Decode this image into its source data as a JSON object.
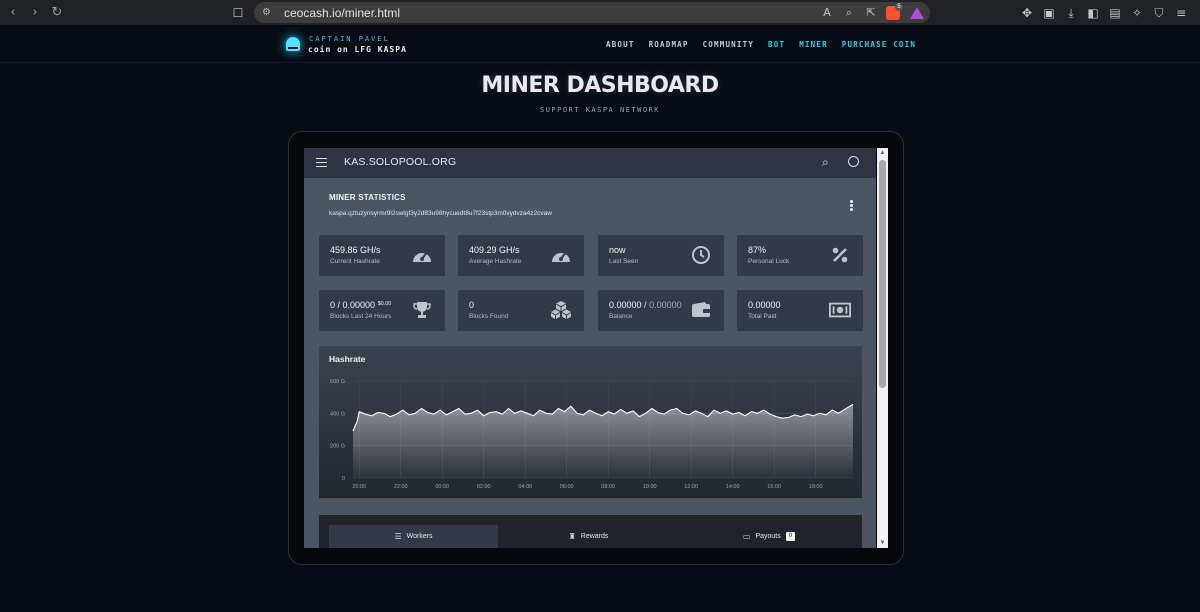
{
  "browser": {
    "url": "ceocash.io/miner.html",
    "extension_badge": "5"
  },
  "site": {
    "brand_top": "CAPTAIN PAVEL",
    "brand_bottom": "coin on LFG KASPA",
    "nav": [
      {
        "label": "ABOUT",
        "active": false
      },
      {
        "label": "ROADMAP",
        "active": false
      },
      {
        "label": "COMMUNITY",
        "active": false
      },
      {
        "label": "BOT",
        "active": true
      },
      {
        "label": "MINER",
        "active": true
      },
      {
        "label": "PURCHASE COIN",
        "active": true
      }
    ],
    "accent_color": "#22d3ee",
    "hero_title": "MINER DASHBOARD",
    "hero_subtitle": "SUPPORT KASPA NETWORK"
  },
  "app": {
    "title": "KAS.SOLOPOOL.ORG",
    "section_title": "MINER STATISTICS",
    "wallet_address": "kaspa:qztuzynsyrmr9l2swlgf3y2d83u98hycuedt8u7f23stp3m0vydvza4z2cvaw",
    "stats": [
      {
        "value": "459.86 GH/s",
        "label": "Current Hashrate",
        "icon": "gauge-icon"
      },
      {
        "value": "409.29 GH/s",
        "label": "Average Hashrate",
        "icon": "gauge-icon"
      },
      {
        "value": "now",
        "label": "Last Seen",
        "icon": "clock-icon"
      },
      {
        "value": "87%",
        "label": "Personal Luck",
        "icon": "percent-icon"
      },
      {
        "value": "0 / 0.00000",
        "value_sup": "$0.00",
        "label": "Blocks Last 24 Hours",
        "icon": "trophy-icon"
      },
      {
        "value": "0",
        "label": "Blocks Found",
        "icon": "cubes-icon"
      },
      {
        "value": "0.00000 /",
        "value_muted": "0.00000",
        "label": "Balance",
        "icon": "wallet-icon"
      },
      {
        "value": "0.00000",
        "label": "Total Paid",
        "icon": "money-bill-icon"
      }
    ],
    "tabs": [
      {
        "label": "Workers",
        "icon": "server-icon",
        "active": true
      },
      {
        "label": "Rewards",
        "icon": "trophy-icon",
        "active": false
      },
      {
        "label": "Payouts",
        "icon": "money-bill-icon",
        "active": false,
        "count": "0"
      }
    ]
  },
  "chart_data": {
    "type": "area",
    "title": "Hashrate",
    "y_ticks": [
      "0",
      "200 G",
      "400 G",
      "600 G"
    ],
    "ylim": [
      0,
      600
    ],
    "x_ticks": [
      "20:00",
      "22:00",
      "00:00",
      "02:00",
      "04:00",
      "06:00",
      "08:00",
      "10:00",
      "12:00",
      "14:00",
      "16:00",
      "18:00"
    ],
    "xlim_hours": [
      19.7,
      43.8
    ],
    "grid": true,
    "color": "#ffffff",
    "x": [
      19.7,
      19.9,
      20.0,
      20.3,
      20.6,
      20.9,
      21.2,
      21.5,
      21.8,
      22.1,
      22.4,
      22.7,
      23.0,
      23.3,
      23.6,
      23.9,
      24.2,
      24.5,
      24.8,
      25.1,
      25.4,
      25.7,
      26.0,
      26.3,
      26.6,
      26.9,
      27.2,
      27.5,
      27.8,
      28.1,
      28.4,
      28.7,
      29.0,
      29.3,
      29.6,
      29.9,
      30.2,
      30.5,
      30.8,
      31.1,
      31.4,
      31.7,
      32.0,
      32.3,
      32.6,
      32.9,
      33.2,
      33.5,
      33.8,
      34.1,
      34.4,
      34.7,
      35.0,
      35.3,
      35.6,
      35.9,
      36.2,
      36.5,
      36.8,
      37.1,
      37.4,
      37.7,
      38.0,
      38.3,
      38.6,
      38.9,
      39.2,
      39.5,
      39.8,
      40.1,
      40.4,
      40.7,
      41.0,
      41.3,
      41.6,
      41.9,
      42.2,
      42.5,
      42.8,
      43.1,
      43.4,
      43.8
    ],
    "y": [
      290,
      350,
      410,
      395,
      385,
      405,
      400,
      380,
      395,
      420,
      390,
      400,
      430,
      405,
      395,
      420,
      390,
      410,
      430,
      395,
      400,
      420,
      385,
      405,
      410,
      395,
      430,
      400,
      415,
      400,
      385,
      420,
      400,
      395,
      430,
      410,
      445,
      400,
      390,
      420,
      400,
      385,
      410,
      395,
      425,
      400,
      415,
      380,
      400,
      430,
      405,
      395,
      420,
      430,
      400,
      390,
      415,
      400,
      380,
      420,
      400,
      415,
      395,
      405,
      385,
      410,
      400,
      420,
      395,
      380,
      370,
      375,
      390,
      380,
      395,
      385,
      400,
      390,
      420,
      400,
      425,
      455
    ]
  }
}
